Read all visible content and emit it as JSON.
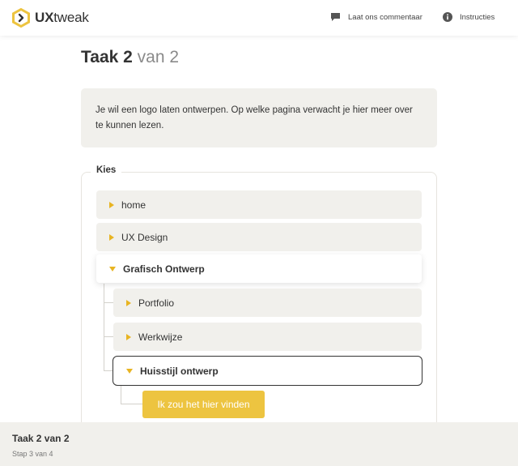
{
  "header": {
    "logo_text_bold": "UX",
    "logo_text_rest": "tweak",
    "comment_label": "Laat ons commentaar",
    "instructions_label": "Instructies"
  },
  "task": {
    "title_bold": "Taak 2",
    "title_rest": "van 2",
    "question": "Je wil een logo laten ontwerpen. Op welke pagina verwacht je hier meer over te kunnen lezen."
  },
  "tree": {
    "legend": "Kies",
    "items": [
      {
        "label": "home",
        "state": "collapsed"
      },
      {
        "label": "UX Design",
        "state": "collapsed"
      },
      {
        "label": "Grafisch Ontwerp",
        "state": "expanded"
      },
      {
        "label": "Portfolio",
        "state": "collapsed"
      },
      {
        "label": "Werkwijze",
        "state": "collapsed"
      },
      {
        "label": "Huisstijl ontwerp",
        "state": "selected"
      }
    ],
    "confirm_label": "Ik zou het hier vinden"
  },
  "footer": {
    "title": "Taak 2 van 2",
    "subtitle": "Stap 3 van 4"
  },
  "colors": {
    "accent": "#edc440",
    "arrow": "#e8b422",
    "item_bg": "#f1f0ec"
  }
}
